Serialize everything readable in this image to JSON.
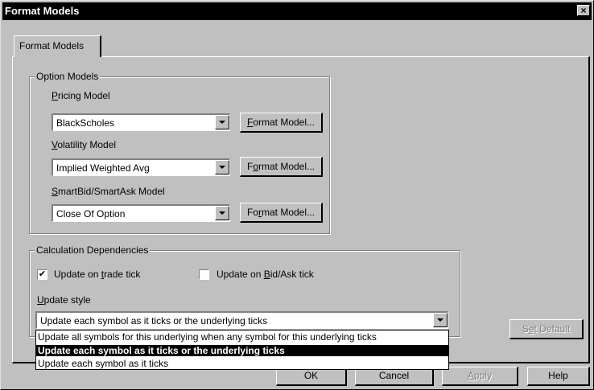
{
  "window": {
    "title": "Format Models",
    "close_glyph": "×"
  },
  "tab": {
    "label": "Format Models"
  },
  "option_models": {
    "group_label": "Option Models",
    "pricing": {
      "label": "Pricing Model",
      "accel": "P",
      "rest": "ricing Model",
      "value": "BlackScholes",
      "button": {
        "pre": "",
        "accel": "F",
        "post": "ormat Model..."
      }
    },
    "volatility": {
      "label": "Volatility Model",
      "accel": "V",
      "rest": "olatility Model",
      "value": "Implied Weighted Avg",
      "button": {
        "pre": "F",
        "accel": "o",
        "post": "rmat Model..."
      }
    },
    "smart": {
      "label": "SmartBid/SmartAsk Model",
      "accel": "S",
      "rest": "martBid/SmartAsk Model",
      "value": "Close Of Option",
      "button": {
        "pre": "Fo",
        "accel": "r",
        "post": "mat Model..."
      }
    }
  },
  "calc": {
    "group_label": "Calculation Dependencies",
    "trade_tick": {
      "pre": "Update on ",
      "accel": "t",
      "post": "rade tick",
      "checked": true,
      "check_glyph": "✔"
    },
    "bidask_tick": {
      "pre": "Update on ",
      "accel": "B",
      "post": "id/Ask tick",
      "checked": false
    },
    "style_label": {
      "accel": "U",
      "rest": "pdate style"
    },
    "style_value": "Update each symbol as it ticks or the underlying ticks",
    "options": [
      "Update all symbols for this underlying when any symbol for this underlying ticks",
      "Update each symbol as it ticks or the underlying ticks",
      "Update each symbol as it ticks"
    ],
    "selected_index": 1
  },
  "buttons": {
    "set_default": {
      "pre": "S",
      "accel": "e",
      "post": "t Default"
    },
    "ok": "OK",
    "cancel": "Cancel",
    "apply": {
      "accel": "A",
      "post": "pply"
    },
    "help": "Help"
  }
}
